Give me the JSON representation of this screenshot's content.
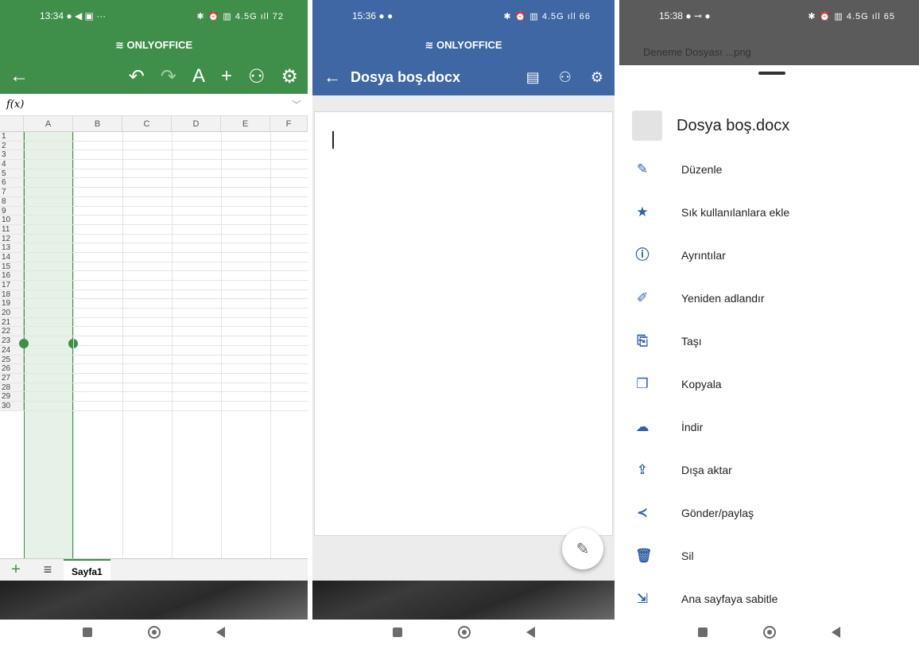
{
  "panel1": {
    "status": {
      "time": "13:34",
      "icons_left": "● ◀ ▣ ···",
      "icons_right": "✱ ⏰ ▥ 4.5G ıll 72"
    },
    "brand": "≋ ONLYOFFICE",
    "toolbar": {
      "back": "←",
      "undo": "↶",
      "redo": "↷",
      "format": "A",
      "add": "+",
      "users": "⚇",
      "settings": "⚙"
    },
    "fx_label": "f(x)",
    "fx_chevron": "﹀",
    "columns": [
      "A",
      "B",
      "C",
      "D",
      "E",
      "F"
    ],
    "rows": [
      "1",
      "2",
      "3",
      "4",
      "5",
      "6",
      "7",
      "8",
      "9",
      "10",
      "11",
      "12",
      "13",
      "14",
      "15",
      "16",
      "17",
      "18",
      "19",
      "20",
      "21",
      "22",
      "23",
      "24",
      "25",
      "26",
      "27",
      "28",
      "29",
      "30"
    ],
    "sheetbar": {
      "add": "+",
      "menu": "≡",
      "tab": "Sayfa1"
    },
    "accent": "#3f8f4a"
  },
  "panel2": {
    "status": {
      "time": "15:36",
      "icons_left": "● ●",
      "icons_right": "✱ ⏰ ▥ 4.5G ıll 66"
    },
    "brand": "≋ ONLYOFFICE",
    "toolbar": {
      "back": "←",
      "title": "Dosya boş.docx",
      "view_icon": "▤",
      "users_icon": "⚇",
      "settings_icon": "⚙"
    },
    "fab_icon": "✎",
    "accent": "#3e67a3"
  },
  "panel3": {
    "status": {
      "time": "15:38",
      "icons_left": "● ⊸ ●",
      "icons_right": "✱ ⏰ ▥ 4.5G ıll 65"
    },
    "behind_text": "Deneme Dosyası  ...png",
    "file_name": "Dosya boş.docx",
    "menu": [
      {
        "icon": "✎",
        "label": "Düzenle"
      },
      {
        "icon": "★",
        "label": "Sık kullanılanlara ekle"
      },
      {
        "icon": "ⓘ",
        "label": "Ayrıntılar"
      },
      {
        "icon": "✐",
        "label": "Yeniden adlandır"
      },
      {
        "icon": "⎘",
        "label": "Taşı"
      },
      {
        "icon": "❐",
        "label": "Kopyala"
      },
      {
        "icon": "☁",
        "label": "İndir"
      },
      {
        "icon": "⇪",
        "label": "Dışa aktar"
      },
      {
        "icon": "≺",
        "label": "Gönder/paylaş"
      },
      {
        "icon": "🗑",
        "label": "Sil"
      },
      {
        "icon": "⇲",
        "label": "Ana sayfaya sabitle"
      }
    ],
    "accent": "#2f5fa8"
  }
}
